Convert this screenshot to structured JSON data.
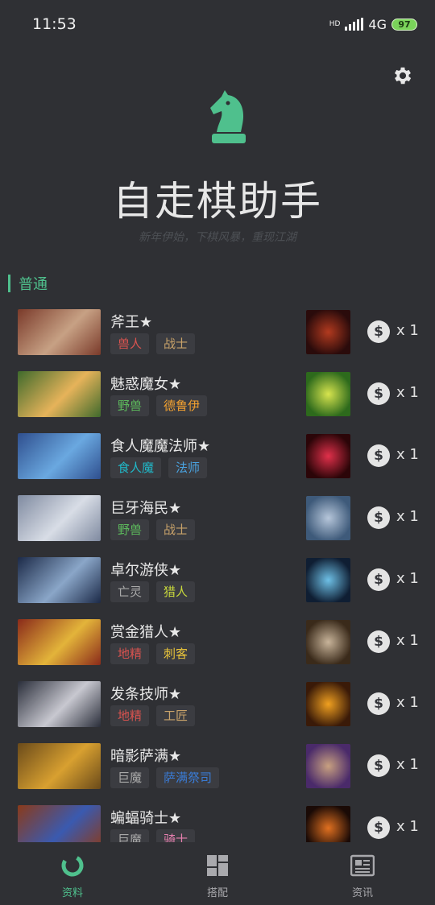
{
  "status_bar": {
    "time": "11:53",
    "network": "4G",
    "hd": "HD",
    "battery": "97"
  },
  "header": {
    "title": "自走棋助手",
    "subtitle": "新年伊始，下棋风暴，重现江湖",
    "settings_icon": "gear-icon",
    "logo_icon": "chess-knight-icon"
  },
  "section": {
    "title": "普通"
  },
  "colors": {
    "accent": "#4fc08d",
    "background": "#2f3034",
    "tag_bg": "#3b3c41"
  },
  "heroes": [
    {
      "name": "斧王★",
      "tags": [
        {
          "label": "兽人",
          "color": "#d9534f"
        },
        {
          "label": "战士",
          "color": "#c9a36a"
        }
      ],
      "cost": "x 1",
      "portrait_colors": [
        "#7a3a2a",
        "#c7a184"
      ],
      "skill_colors": [
        "#2a0b0b",
        "#b23a1f"
      ]
    },
    {
      "name": "魅惑魔女★",
      "tags": [
        {
          "label": "野兽",
          "color": "#5cb85c"
        },
        {
          "label": "德鲁伊",
          "color": "#f0a030"
        }
      ],
      "cost": "x 1",
      "portrait_colors": [
        "#3f6a2c",
        "#e6b35a"
      ],
      "skill_colors": [
        "#2d6a1c",
        "#d7e44e"
      ]
    },
    {
      "name": "食人魔魔法师★",
      "tags": [
        {
          "label": "食人魔",
          "color": "#20b8c8"
        },
        {
          "label": "法师",
          "color": "#4aa3e0"
        }
      ],
      "cost": "x 1",
      "portrait_colors": [
        "#2f4f8e",
        "#6aa8e0"
      ],
      "skill_colors": [
        "#2b0508",
        "#e0304a"
      ]
    },
    {
      "name": "巨牙海民★",
      "tags": [
        {
          "label": "野兽",
          "color": "#5cb85c"
        },
        {
          "label": "战士",
          "color": "#c9a36a"
        }
      ],
      "cost": "x 1",
      "portrait_colors": [
        "#7f8aa0",
        "#d8dde6"
      ],
      "skill_colors": [
        "#3e5a7a",
        "#b6c6da"
      ]
    },
    {
      "name": "卓尔游侠★",
      "tags": [
        {
          "label": "亡灵",
          "color": "#a9a9a9"
        },
        {
          "label": "猎人",
          "color": "#c8d83c"
        }
      ],
      "cost": "x 1",
      "portrait_colors": [
        "#1c2a48",
        "#8aa6c8"
      ],
      "skill_colors": [
        "#0f1e33",
        "#6ec0e6"
      ]
    },
    {
      "name": "赏金猎人★",
      "tags": [
        {
          "label": "地精",
          "color": "#d9534f"
        },
        {
          "label": "刺客",
          "color": "#e8c33a"
        }
      ],
      "cost": "x 1",
      "portrait_colors": [
        "#8a2a1a",
        "#e3b43a"
      ],
      "skill_colors": [
        "#3a2a1a",
        "#c8b49a"
      ]
    },
    {
      "name": "发条技师★",
      "tags": [
        {
          "label": "地精",
          "color": "#d9534f"
        },
        {
          "label": "工匠",
          "color": "#c9a36a"
        }
      ],
      "cost": "x 1",
      "portrait_colors": [
        "#2a2e3a",
        "#c8c8d0"
      ],
      "skill_colors": [
        "#3a1a08",
        "#f0a020"
      ]
    },
    {
      "name": "暗影萨满★",
      "tags": [
        {
          "label": "巨魔",
          "color": "#a9a9a9"
        },
        {
          "label": "萨满祭司",
          "color": "#3a7bd5"
        }
      ],
      "cost": "x 1",
      "portrait_colors": [
        "#6a4a1a",
        "#d8a030"
      ],
      "skill_colors": [
        "#4a2a6a",
        "#c8a080"
      ]
    },
    {
      "name": "蝙蝠骑士★",
      "tags": [
        {
          "label": "巨魔",
          "color": "#a9a9a9"
        },
        {
          "label": "骑士",
          "color": "#e880b0"
        }
      ],
      "cost": "x 1",
      "portrait_colors": [
        "#8a3a1a",
        "#3a5ab0"
      ],
      "skill_colors": [
        "#1a0a06",
        "#e07020"
      ]
    }
  ],
  "coin_symbol": "$",
  "bottom_nav": [
    {
      "label": "资料",
      "icon": "refresh-ring-icon",
      "active": true
    },
    {
      "label": "搭配",
      "icon": "layout-grid-icon",
      "active": false
    },
    {
      "label": "资讯",
      "icon": "newspaper-icon",
      "active": false
    }
  ]
}
